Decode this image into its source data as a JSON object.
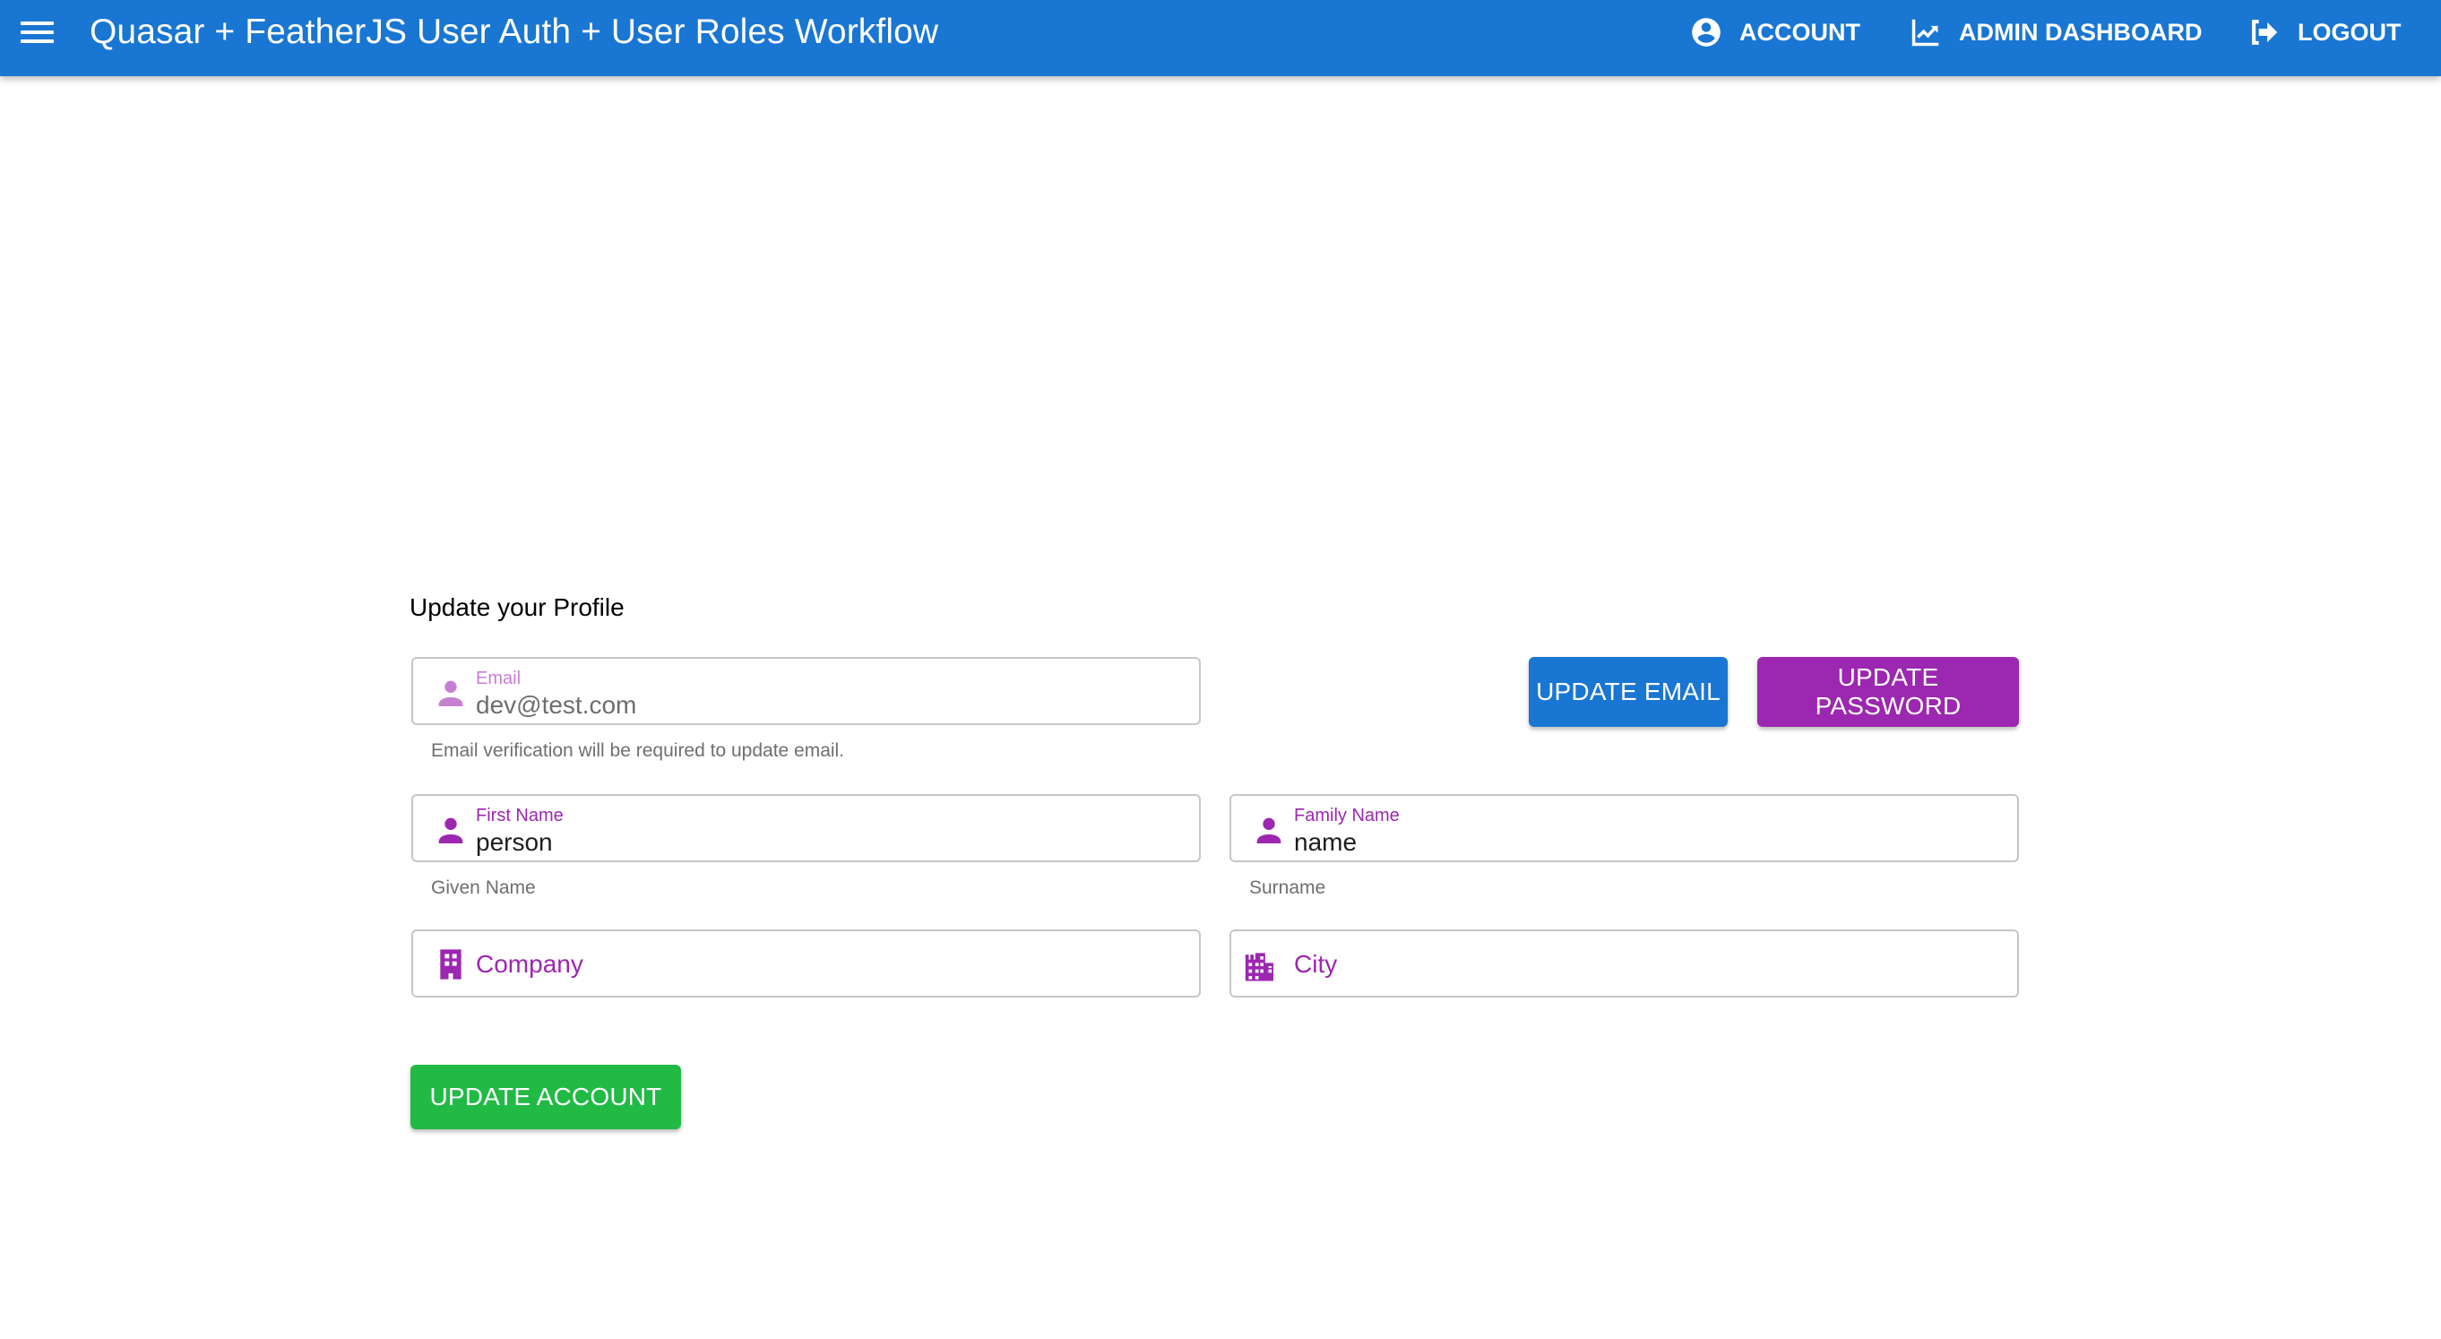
{
  "header": {
    "title": "Quasar + FeatherJS User Auth + User Roles Workflow",
    "menu_icon": "hamburger-menu-icon",
    "nav": [
      {
        "label": "ACCOUNT",
        "icon": "account-circle-icon"
      },
      {
        "label": "ADMIN DASHBOARD",
        "icon": "trending-chart-icon"
      },
      {
        "label": "LOGOUT",
        "icon": "logout-icon"
      }
    ]
  },
  "profile": {
    "title": "Update your Profile",
    "email": {
      "label": "Email",
      "value": "dev@test.com",
      "hint": "Email verification will be required to update email.",
      "icon": "person-icon"
    },
    "first_name": {
      "label": "First Name",
      "value": "person",
      "hint": "Given Name",
      "icon": "person-icon"
    },
    "family_name": {
      "label": "Family Name",
      "value": "name",
      "hint": "Surname",
      "icon": "person-icon"
    },
    "company": {
      "placeholder": "Company",
      "icon": "office-building-icon"
    },
    "city": {
      "placeholder": "City",
      "icon": "city-buildings-icon"
    },
    "buttons": {
      "update_email": "UPDATE EMAIL",
      "update_password": "UPDATE PASSWORD",
      "update_account": "UPDATE ACCOUNT"
    }
  },
  "colors": {
    "primary": "#1976D2",
    "secondary": "#9C27B0",
    "positive": "#21BA45"
  }
}
